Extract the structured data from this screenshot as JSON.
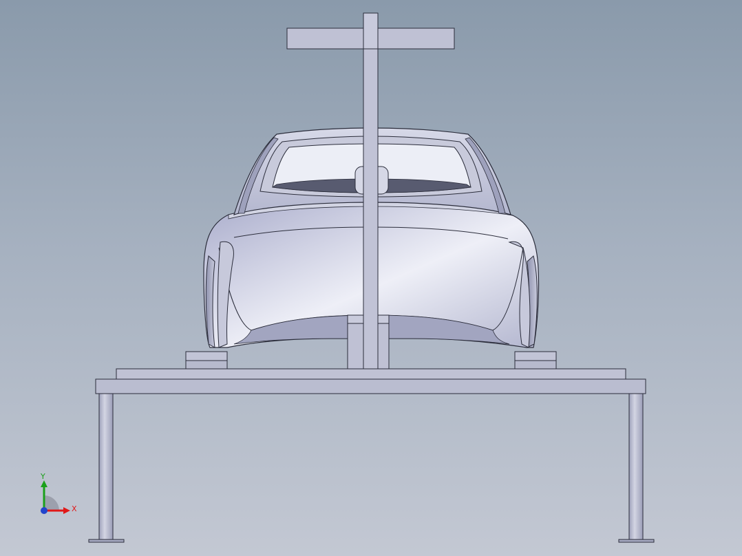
{
  "viewport": {
    "background_top": "#8a9aab",
    "background_bottom": "#c3c8d3"
  },
  "model": {
    "part_fill": "#b9bccf",
    "edge_color": "#2a2c3a"
  },
  "triad": {
    "x_label": "X",
    "y_label": "Y",
    "x_color": "#e01818",
    "y_color": "#1aa01a",
    "z_color": "#2244cc"
  }
}
